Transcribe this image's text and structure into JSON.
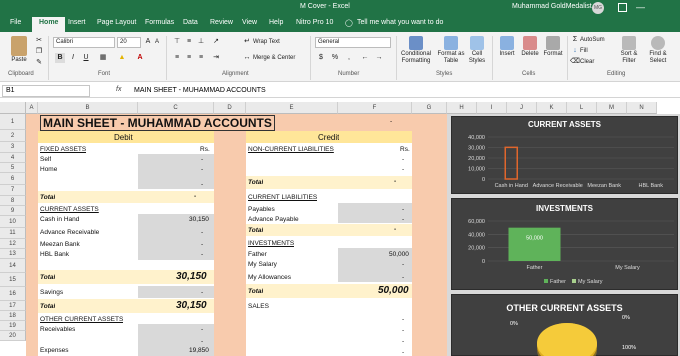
{
  "titlebar": {
    "save_label": "M Cover",
    "doc_title": "M Cover  -  Excel",
    "user": "Muhammad GoldMedalist",
    "avatar": "MG",
    "minimize": "—"
  },
  "tabs": [
    "File",
    "Home",
    "Insert",
    "Page Layout",
    "Formulas",
    "Data",
    "Review",
    "View",
    "Help",
    "Nitro Pro 10"
  ],
  "tell_me": "Tell me what you want to do",
  "ribbon": {
    "clipboard": {
      "paste": "Paste",
      "label": "Clipboard"
    },
    "font": {
      "name": "Calibri",
      "size": "20",
      "bold": "B",
      "italic": "I",
      "underline": "U",
      "label": "Font"
    },
    "alignment": {
      "wrap": "Wrap Text",
      "merge": "Merge & Center",
      "label": "Alignment"
    },
    "number": {
      "format": "General",
      "label": "Number"
    },
    "styles": {
      "conditional": "Conditional Formatting",
      "table": "Format as Table",
      "cell": "Cell Styles",
      "label": "Styles"
    },
    "cells": {
      "insert": "Insert",
      "delete": "Delete",
      "format": "Format",
      "label": "Cells"
    },
    "editing": {
      "autosum": "AutoSum",
      "fill": "Fill",
      "clear": "Clear",
      "sort": "Sort & Filter",
      "find": "Find & Select",
      "label": "Editing"
    }
  },
  "formula_bar": {
    "name_box": "B1",
    "fx": "fx",
    "content": "MAIN SHEET - MUHAMMAD ACCOUNTS"
  },
  "columns": [
    "A",
    "B",
    "C",
    "D",
    "E",
    "F",
    "G",
    "H",
    "I",
    "J",
    "K",
    "L",
    "M",
    "N"
  ],
  "rows": [
    "1",
    "2",
    "3",
    "4",
    "5",
    "6",
    "7",
    "8",
    "9",
    "10",
    "11",
    "12",
    "13",
    "14",
    "15",
    "16",
    "17",
    "18",
    "19",
    "20"
  ],
  "sheet": {
    "title": "MAIN SHEET - MUHAMMAD ACCOUNTS",
    "title_dash": "-",
    "debit": "Debit",
    "credit": "Credit",
    "fixed_assets": "FIXED ASSETS",
    "rs": "Rs.",
    "self": "Self",
    "home": "Home",
    "total": "Total",
    "current_assets": "CURRENT ASSETS",
    "cash_in_hand": "Cash in Hand",
    "cash_value": "30,150",
    "advance_receivable": "Advance Receivable",
    "meezan_bank": "Meezan Bank",
    "hbl_bank": "HBL Bank",
    "total14": "30,150",
    "savings": "Savings",
    "total16": "30,150",
    "other_current_assets": "OTHER CURRENT ASSETS",
    "receivables": "Receivables",
    "expenses": "Expenses",
    "expenses_value": "19,850",
    "dash": "-",
    "non_current_liabilities": "NON-CURRENT LIABILITIES",
    "current_liabilities": "CURRENT LIABILITIES",
    "payables": "Payables",
    "advance_payable": "Advance Payable",
    "investments": "INVESTMENTS",
    "father": "Father",
    "father_value": "50,000",
    "my_salary": "My Salary",
    "my_allowances": "My Allowances",
    "total15": "50,000",
    "sales": "SALES"
  },
  "chart_data": [
    {
      "type": "bar",
      "title": "CURRENT ASSETS",
      "categories": [
        "Cash in Hand",
        "Advance Receivable",
        "Meezan Bank",
        "HBL Bank"
      ],
      "values": [
        30150,
        0,
        0,
        0
      ],
      "ylim": [
        0,
        40000
      ],
      "yticks": [
        "40,000",
        "30,000",
        "20,000",
        "10,000",
        "0"
      ],
      "grid": true,
      "selected_bar_color": "#e0662c"
    },
    {
      "type": "bar",
      "title": "INVESTMENTS",
      "categories": [
        "Father",
        "My Salary"
      ],
      "values": [
        50000,
        0
      ],
      "data_labels": [
        "50,000"
      ],
      "ylim": [
        0,
        60000
      ],
      "yticks": [
        "60,000",
        "40,000",
        "20,000",
        "0"
      ],
      "legend": [
        "Father",
        "My Salary"
      ],
      "legend_position": "bottom",
      "colors": [
        "#5fb35a",
        "#a8d08d"
      ]
    },
    {
      "type": "pie",
      "title": "OTHER CURRENT ASSETS",
      "data_labels": [
        "0%",
        "0%",
        "100%"
      ],
      "colors": [
        "#f2c12e"
      ]
    }
  ],
  "colors": {
    "excel_green": "#217346",
    "debit_fill": "#f8cbad",
    "header_fill": "#ffe699",
    "chart_bg": "#404040"
  }
}
